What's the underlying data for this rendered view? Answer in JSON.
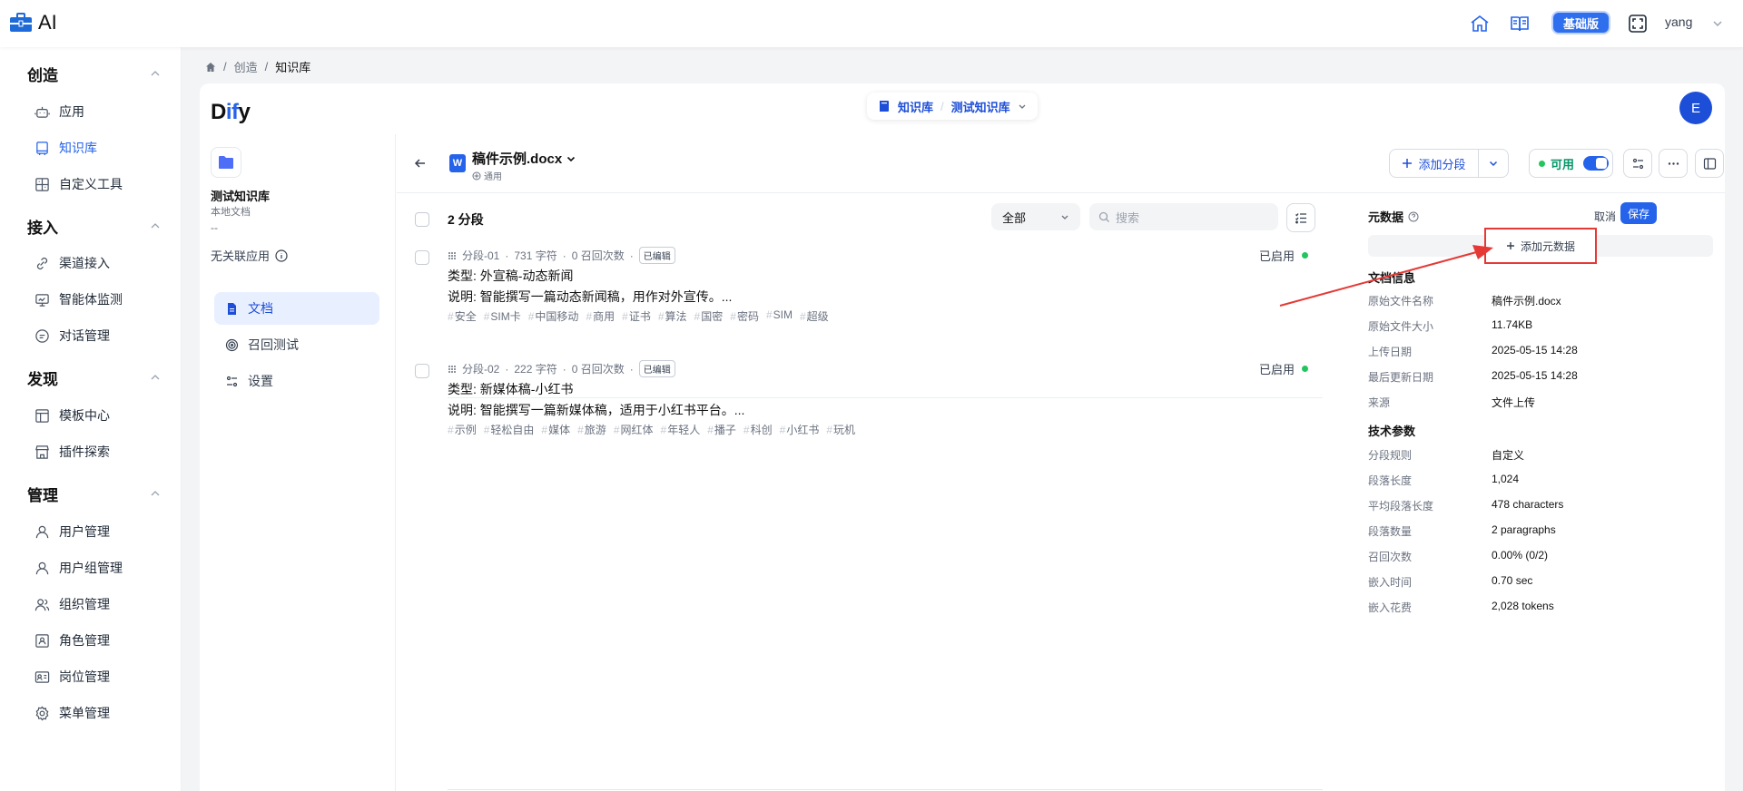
{
  "app": {
    "title": "AI"
  },
  "topbar": {
    "edition": "基础版",
    "username": "yang"
  },
  "sidebar": {
    "sections": [
      {
        "title": "创造",
        "items": [
          {
            "label": "应用"
          },
          {
            "label": "知识库"
          },
          {
            "label": "自定义工具"
          }
        ]
      },
      {
        "title": "接入",
        "items": [
          {
            "label": "渠道接入"
          },
          {
            "label": "智能体监测"
          },
          {
            "label": "对话管理"
          }
        ]
      },
      {
        "title": "发现",
        "items": [
          {
            "label": "模板中心"
          },
          {
            "label": "插件探索"
          }
        ]
      },
      {
        "title": "管理",
        "items": [
          {
            "label": "用户管理"
          },
          {
            "label": "用户组管理"
          },
          {
            "label": "组织管理"
          },
          {
            "label": "角色管理"
          },
          {
            "label": "岗位管理"
          },
          {
            "label": "菜单管理"
          }
        ]
      }
    ],
    "active_item": "知识库"
  },
  "breadcrumb": {
    "items": [
      "创造",
      "知识库"
    ]
  },
  "dify": {
    "logo": "Dify",
    "switcher": {
      "left": "知识库",
      "right": "测试知识库"
    },
    "avatar_letter": "E"
  },
  "dataset": {
    "name": "测试知识库",
    "description": "本地文档",
    "dash": "--",
    "no_app": "无关联应用",
    "nav": [
      {
        "label": "文档"
      },
      {
        "label": "召回测试"
      },
      {
        "label": "设置"
      }
    ]
  },
  "document": {
    "title": "稿件示例.docx",
    "mode": "通用",
    "add_segment": "添加分段",
    "available": "可用",
    "segment_count": "2 分段",
    "filter": "全部",
    "search_placeholder": "搜索",
    "segments": [
      {
        "id": "分段-01",
        "chars": "731 字符",
        "recalls": "0 召回次数",
        "edited": "已编辑",
        "line1": "类型: 外宣稿-动态新闻",
        "line2": "说明: 智能撰写一篇动态新闻稿，用作对外宣传。...",
        "tags": [
          "安全",
          "SIM卡",
          "中国移动",
          "商用",
          "证书",
          "算法",
          "国密",
          "密码",
          "SIM",
          "超级"
        ],
        "status": "已启用"
      },
      {
        "id": "分段-02",
        "chars": "222 字符",
        "recalls": "0 召回次数",
        "edited": "已编辑",
        "line1": "类型: 新媒体稿-小红书",
        "line2": "说明: 智能撰写一篇新媒体稿，适用于小红书平台。...",
        "tags": [
          "示例",
          "轻松自由",
          "媒体",
          "旅游",
          "网红体",
          "年轻人",
          "播子",
          "科创",
          "小红书",
          "玩机"
        ],
        "status": "已启用"
      }
    ]
  },
  "metadata": {
    "title": "元数据",
    "cancel": "取消",
    "save": "保存",
    "add_button": "添加元数据",
    "doc_info_title": "文档信息",
    "doc_info": [
      {
        "k": "原始文件名称",
        "v": "稿件示例.docx"
      },
      {
        "k": "原始文件大小",
        "v": "11.74KB"
      },
      {
        "k": "上传日期",
        "v": "2025-05-15 14:28"
      },
      {
        "k": "最后更新日期",
        "v": "2025-05-15 14:28"
      },
      {
        "k": "来源",
        "v": "文件上传"
      }
    ],
    "tech_title": "技术参数",
    "tech": [
      {
        "k": "分段规则",
        "v": "自定义"
      },
      {
        "k": "段落长度",
        "v": "1,024"
      },
      {
        "k": "平均段落长度",
        "v": "478 characters"
      },
      {
        "k": "段落数量",
        "v": "2 paragraphs"
      },
      {
        "k": "召回次数",
        "v": "0.00% (0/2)"
      },
      {
        "k": "嵌入时间",
        "v": "0.70 sec"
      },
      {
        "k": "嵌入花费",
        "v": "2,028 tokens"
      }
    ]
  },
  "colors": {
    "accent": "#2563eb",
    "highlight": "#e53935",
    "status_green": "#22c55e"
  }
}
